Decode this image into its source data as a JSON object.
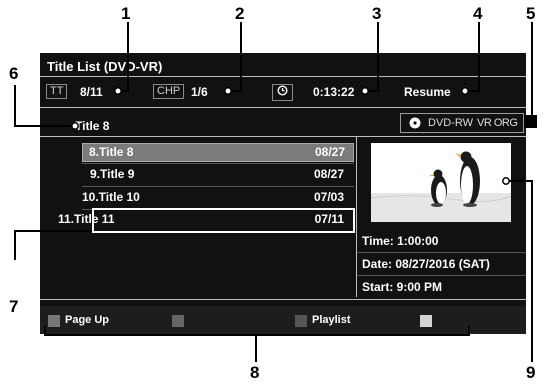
{
  "header": {
    "title": "Title List (DVD-VR)",
    "tt_label": "TT",
    "tt_value": "8/11",
    "chp_label": "CHP",
    "chp_value": "1/6",
    "time": "0:13:22",
    "mode": "Resume"
  },
  "selected_title": "Title 8",
  "disc": {
    "type": "DVD-RW",
    "format": "VR ORG"
  },
  "titles": [
    {
      "name": "8.Title 8",
      "date": "08/27"
    },
    {
      "name": "9.Title 9",
      "date": "08/27"
    },
    {
      "name": "10.Title 10",
      "date": "07/03"
    },
    {
      "name": "11.Title 11",
      "date": "07/11"
    }
  ],
  "info": {
    "time": "Time: 1:00:00",
    "date": "Date: 08/27/2016 (SAT)",
    "start": "Start: 9:00 PM"
  },
  "footer": {
    "page_up": "Page Up",
    "playlist": "Playlist"
  },
  "footer_colors": [
    "#c62828",
    "#2e7d32",
    "#1565c0",
    "#f9a825"
  ],
  "callouts": [
    "1",
    "2",
    "3",
    "4",
    "5",
    "6",
    "7",
    "8",
    "9"
  ]
}
